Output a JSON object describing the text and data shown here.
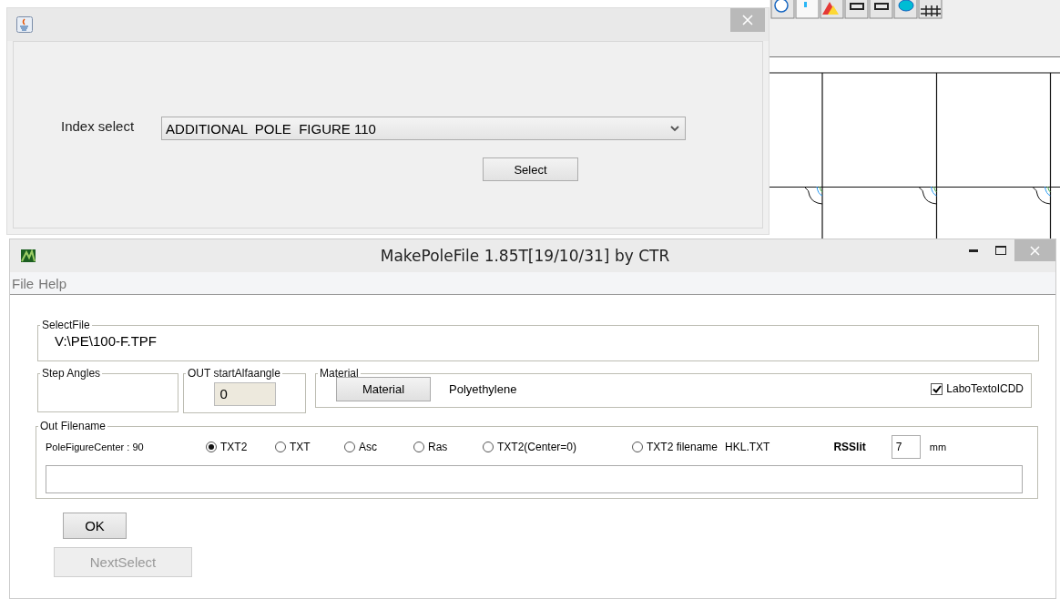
{
  "index_dialog": {
    "label": "Index select",
    "index_combo": {
      "value": "ADDITIONAL  POLE  FIGURE 110"
    },
    "select_button": "Select"
  },
  "main_window": {
    "title": "MakePoleFile 1.85T[19/10/31] by CTR",
    "menu": [
      "File",
      "Help"
    ],
    "select_file": {
      "legend": "SelectFile",
      "path": "V:\\PE\\100-F.TPF"
    },
    "step_angles": {
      "legend": "Step Angles"
    },
    "out_start": {
      "legend": "OUT startAlfaangle",
      "value": "0"
    },
    "material": {
      "legend": "Material",
      "button": "Material",
      "name": "Polyethylene",
      "checkbox": {
        "label": "LaboTextoICDD",
        "checked": true
      }
    },
    "out_filename": {
      "legend": "Out Filename",
      "center_label": "PoleFigureCenter : 90",
      "formats": [
        {
          "label": "TXT2",
          "selected": true
        },
        {
          "label": "TXT",
          "selected": false
        },
        {
          "label": "Asc",
          "selected": false
        },
        {
          "label": "Ras",
          "selected": false
        },
        {
          "label": "TXT2(Center=0)",
          "selected": false
        },
        {
          "label": "TXT2 filename",
          "selected": false
        }
      ],
      "hkl_file": "HKL.TXT",
      "rsslit": {
        "label": "RSSlit",
        "value": "7",
        "unit": "mm"
      }
    },
    "buttons": [
      {
        "label": "OK",
        "disabled": false
      },
      {
        "label": "NextSelect",
        "disabled": true
      }
    ]
  }
}
